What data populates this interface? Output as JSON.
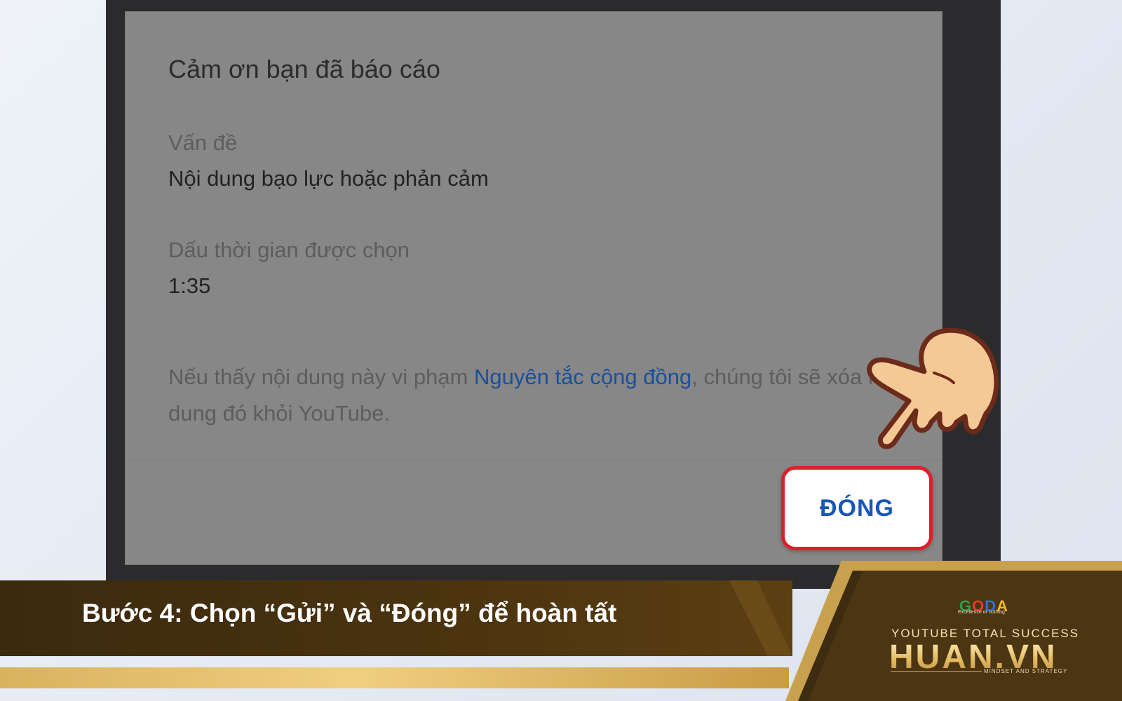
{
  "dialog": {
    "title": "Cảm ơn bạn đã báo cáo",
    "issue_label": "Vấn đề",
    "issue_value": "Nội dung bạo lực hoặc phản cảm",
    "timestamp_label": "Dấu thời gian được chọn",
    "timestamp_value": "1:35",
    "note_prefix": "Nếu thấy nội dung này vi phạm ",
    "note_link": "Nguyên tắc cộng đồng",
    "note_suffix": ", chúng tôi sẽ xóa nội dung đó khỏi YouTube.",
    "close_label": "ĐÓNG"
  },
  "banner": {
    "step_text": "Bước 4: Chọn “Gửi” và “Đóng” để hoàn tất"
  },
  "brand": {
    "goda_logo": "GODA",
    "goda_tagline": "Excellence or nothing",
    "tagline_top": "YOUTUBE TOTAL SUCCESS",
    "name": "HUAN.VN",
    "tagline_bottom": "MINDSET AND STRATEGY"
  },
  "colors": {
    "close_border": "#e01e2b",
    "close_text": "#1956b7",
    "link": "#1a4f9c",
    "banner_dark": "#3b2a0e",
    "banner_gold": "#e3bc62"
  },
  "icons": {
    "pointer": "pointing-hand-icon"
  }
}
